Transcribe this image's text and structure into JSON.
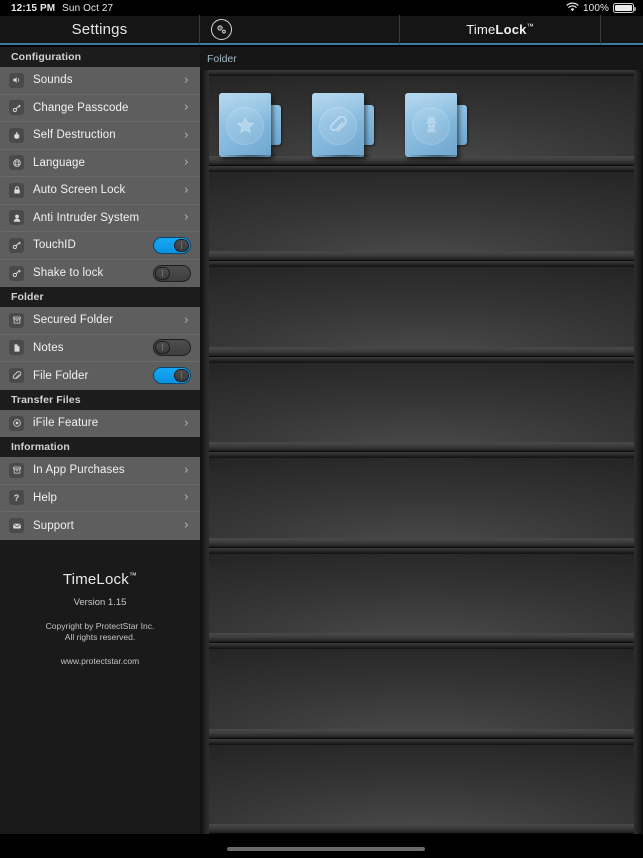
{
  "status_bar": {
    "time": "12:15 PM",
    "date": "Sun Oct 27",
    "wifi_icon": "wifi-icon",
    "battery_percent": "100%",
    "battery_icon": "battery-full-icon"
  },
  "nav_bar": {
    "settings_title": "Settings",
    "gear_icon": "gear-icon",
    "app_title_regular": "Time",
    "app_title_bold": "Lock",
    "app_title_tm": "™"
  },
  "sidebar": {
    "sections": [
      {
        "header": "Configuration",
        "items": [
          {
            "label": "Sounds",
            "icon": "speaker-icon",
            "accessory": "chevron"
          },
          {
            "label": "Change Passcode",
            "icon": "key-icon",
            "accessory": "chevron"
          },
          {
            "label": "Self Destruction",
            "icon": "bomb-icon",
            "accessory": "chevron"
          },
          {
            "label": "Language",
            "icon": "globe-icon",
            "accessory": "chevron"
          },
          {
            "label": "Auto Screen Lock",
            "icon": "lock-icon",
            "accessory": "chevron"
          },
          {
            "label": "Anti Intruder System",
            "icon": "intruder-icon",
            "accessory": "chevron"
          },
          {
            "label": "TouchID",
            "icon": "fingerprint-icon",
            "accessory": "toggle",
            "toggle_state": "on"
          },
          {
            "label": "Shake to lock",
            "icon": "shake-icon",
            "accessory": "toggle",
            "toggle_state": "off"
          }
        ]
      },
      {
        "header": "Folder",
        "items": [
          {
            "label": "Secured Folder",
            "icon": "archive-box-icon",
            "accessory": "chevron"
          },
          {
            "label": "Notes",
            "icon": "document-icon",
            "accessory": "toggle",
            "toggle_state": "off"
          },
          {
            "label": "File Folder",
            "icon": "paperclip-icon",
            "accessory": "toggle",
            "toggle_state": "on"
          }
        ]
      },
      {
        "header": "Transfer Files",
        "items": [
          {
            "label": "iFile Feature",
            "icon": "disc-icon",
            "accessory": "chevron"
          }
        ]
      },
      {
        "header": "Information",
        "items": [
          {
            "label": "In App Purchases",
            "icon": "cart-icon",
            "accessory": "chevron"
          },
          {
            "label": "Help",
            "icon": "question-icon",
            "accessory": "chevron"
          },
          {
            "label": "Support",
            "icon": "envelope-icon",
            "accessory": "chevron"
          }
        ]
      }
    ],
    "footer": {
      "title_text": "TimeLock",
      "title_tm": "™",
      "version": "Version 1.15",
      "copyright_line1": "Copyright by ProtectStar Inc.",
      "copyright_line2": "All rights reserved.",
      "website": "www.protectstar.com"
    }
  },
  "main": {
    "header_label": "Folder",
    "folders": [
      {
        "name": "star-folder",
        "icon": "star-icon"
      },
      {
        "name": "files-folder",
        "icon": "paperclip-icon"
      },
      {
        "name": "intruder-folder",
        "icon": "masked-face-icon"
      }
    ],
    "empty_shelf_count": 7
  },
  "colors": {
    "accent_blue": "#3d7b9c",
    "toggle_on": "#17a8f5",
    "folder_blue": "#8cbfe2",
    "sidebar_row_bg": "#5e5e5e",
    "sidebar_section_bg": "#1c1c1c",
    "header_label_blue": "#9fb8c6"
  }
}
